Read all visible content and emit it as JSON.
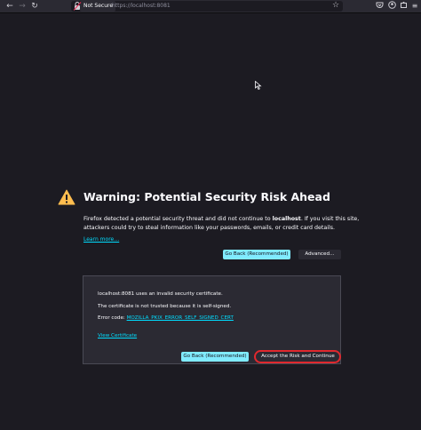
{
  "browser": {
    "back_icon": "←",
    "forward_icon": "→",
    "reload_icon": "↻",
    "not_secure_label": "Not Secure",
    "url": "https://localhost:8081",
    "bookmark_icon": "☆",
    "pocket_icon": "pocket-icon",
    "account_icon": "account-icon",
    "extensions_icon": "extensions-icon",
    "menu_icon": "≡"
  },
  "warning": {
    "title": "Warning: Potential Security Risk Ahead",
    "intro_prefix": "Firefox detected a potential security threat and did not continue to ",
    "intro_host": "localhost",
    "intro_suffix": ". If you visit this site, attackers could try to steal information like your passwords, emails, or credit card details.",
    "learn_more": "Learn more…",
    "go_back_label": "Go Back (Recommended)",
    "advanced_label": "Advanced…"
  },
  "advanced": {
    "line1": "localhost:8081 uses an invalid security certificate.",
    "line2": "The certificate is not trusted because it is self-signed.",
    "error_prefix": "Error code: ",
    "error_code": "MOZILLA_PKIX_ERROR_SELF_SIGNED_CERT",
    "view_certificate": "View Certificate",
    "go_back_label": "Go Back (Recommended)",
    "accept_label": "Accept the Risk and Continue"
  },
  "colors": {
    "background": "#1c1b22",
    "accent": "#80ebff",
    "link": "#00ddff",
    "warning_yellow": "#ffbd4f",
    "highlight_ring": "#e0282e"
  }
}
